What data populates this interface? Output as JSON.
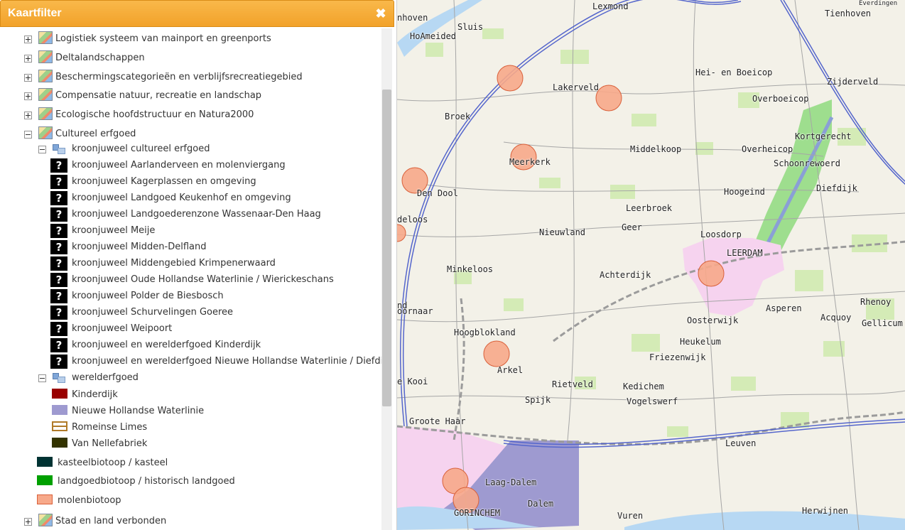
{
  "panel": {
    "title": "Kaartfilter",
    "close_label": "✖"
  },
  "legend_colors": {
    "kinderdijk": "#990000",
    "nieuwe_hollandse_waterlinie": "#9e9ad0",
    "romeinse_limes": "#b07a28",
    "van_nellefabriek": "#333300",
    "kasteelbiotoop": "#003333",
    "landgoedbiotoop": "#00a000",
    "molenbiotoop": "#f7a98a"
  },
  "tree": {
    "logistiek": "Logistiek systeem van mainport en greenports",
    "deltalandschappen": "Deltalandschappen",
    "beschermingscategorieen": "Beschermingscategorieën en verblijfsrecreatiegebied",
    "compensatie": "Compensatie natuur, recreatie en landschap",
    "ecologische": "Ecologische hoofdstructuur en Natura2000",
    "cultureel_erfgoed": "Cultureel erfgoed",
    "kroonjuweel_group": "kroonjuweel cultureel erfgoed",
    "kroonjuwelen": [
      "kroonjuweel Aarlanderveen en molenviergang",
      "kroonjuweel Kagerplassen en omgeving",
      "kroonjuweel Landgoed Keukenhof en omgeving",
      "kroonjuweel Landgoederenzone Wassenaar-Den Haag",
      "kroonjuweel Meije",
      "kroonjuweel Midden-Delfland",
      "kroonjuweel Middengebied Krimpenerwaard",
      "kroonjuweel Oude Hollandse Waterlinie / Wierickeschans",
      "kroonjuweel Polder de Biesbosch",
      "kroonjuweel Schurvelingen Goeree",
      "kroonjuweel Weipoort",
      "kroonjuweel en werelderfgoed Kinderdijk",
      "kroonjuweel en werelderfgoed Nieuwe Hollandse Waterlinie / Diefdijk"
    ],
    "werelderfgoed_group": "werelderfgoed",
    "werelderfgoed": [
      "Kinderdijk",
      "Nieuwe Hollandse Waterlinie",
      "Romeinse Limes",
      "Van Nellefabriek"
    ],
    "kasteelbiotoop": "kasteelbiotoop / kasteel",
    "landgoedbiotoop": "landgoedbiotoop / historisch landgoed",
    "molenbiotoop": "molenbiotoop",
    "stad_en_land": "Stad en land verbonden"
  },
  "map": {
    "places": [
      "Lexmond",
      "Tienhoven",
      "nhoven",
      "Sluis",
      "HoAmeided",
      "Hei- en Boeicop",
      "Zijderveld",
      "Lakerveld",
      "Overboeicop",
      "Broek",
      "Kortgerecht",
      "Middelkoop",
      "Overheicop",
      "Meerkerk",
      "Schoonrewoerd",
      "Den Dool",
      "Diefdijk",
      "Hoogeind",
      "deloos",
      "Leerbroek",
      "Nieuwland",
      "Geer",
      "Loosdorp",
      "LEERDAM",
      "Minkeloos",
      "Achterdijk",
      "Rhenoy",
      "Asperen",
      "nd",
      "oornaar",
      "Oosterwijk",
      "Acquoy",
      "Gellicum",
      "Hoogblokland",
      "Heukelum",
      "Friezenwijk",
      "Arkel",
      "e Kooi",
      "Rietveld",
      "Kedichem",
      "Spijk",
      "Vogelswerf",
      "Groote Haar",
      "Leuven",
      "Laag-Dalem",
      "Dalem",
      "GORINCHEM",
      "Vuren",
      "Herwijnen",
      "Everdingen"
    ]
  }
}
